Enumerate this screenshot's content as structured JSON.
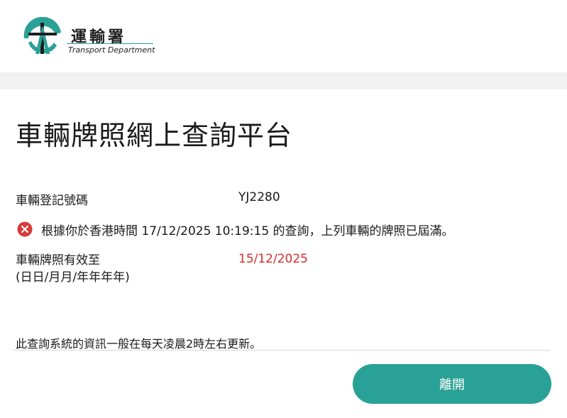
{
  "header": {
    "logo_cn": "運輸署",
    "logo_en": "Transport Department",
    "brand_color": "#2aa196"
  },
  "page": {
    "title": "車輛牌照網上查詢平台"
  },
  "result": {
    "reg_label": "車輛登記號碼",
    "reg_value": "YJ2280",
    "status_icon": "error-circle-x-icon",
    "status_message": "根據你於香港時間 17/12/2025 10:19:15 的查詢，上列車輛的牌照已屆滿。",
    "expiry_label_line1": "車輛牌照有效至",
    "expiry_label_line2": "(日日/月月/年年年年)",
    "expiry_value": "15/12/2025",
    "expiry_color": "#d62d2d"
  },
  "footer": {
    "note": "此查詢系統的資訊一般在每天凌晨2時左右更新。",
    "leave_label": "離開"
  }
}
